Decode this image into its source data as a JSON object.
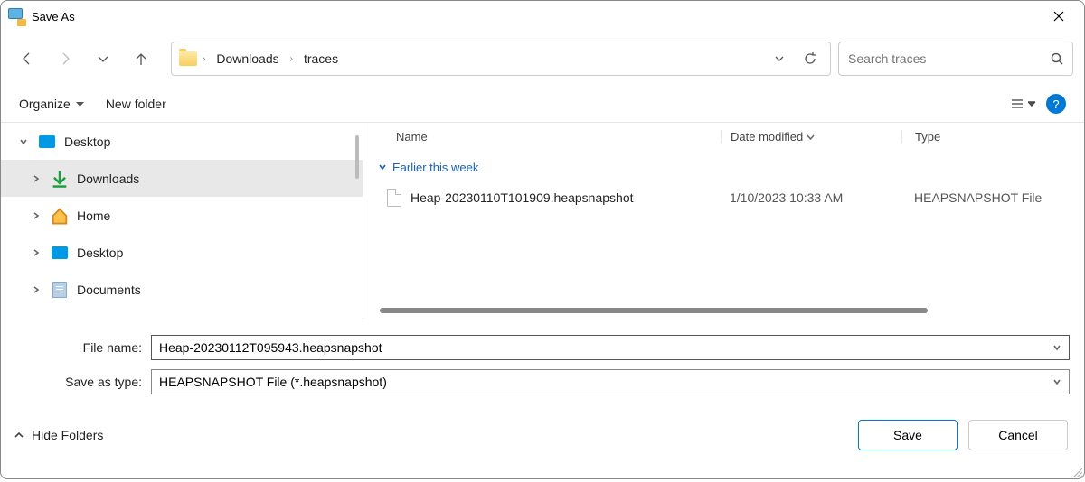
{
  "window": {
    "title": "Save As"
  },
  "breadcrumb": {
    "segments": [
      "Downloads",
      "traces"
    ]
  },
  "search": {
    "placeholder": "Search traces"
  },
  "toolbar": {
    "organize": "Organize",
    "newfolder": "New folder"
  },
  "sidebar": {
    "items": [
      {
        "label": "Desktop"
      },
      {
        "label": "Downloads"
      },
      {
        "label": "Home"
      },
      {
        "label": "Desktop"
      },
      {
        "label": "Documents"
      }
    ]
  },
  "columns": {
    "name": "Name",
    "date": "Date modified",
    "type": "Type"
  },
  "group": {
    "label": "Earlier this week"
  },
  "files": [
    {
      "name": "Heap-20230110T101909.heapsnapshot",
      "date": "1/10/2023 10:33 AM",
      "type": "HEAPSNAPSHOT File"
    }
  ],
  "form": {
    "filename_label": "File name:",
    "filename_value": "Heap-20230112T095943.heapsnapshot",
    "savetype_label": "Save as type:",
    "savetype_value": "HEAPSNAPSHOT File (*.heapsnapshot)"
  },
  "footer": {
    "hide_folders": "Hide Folders",
    "save": "Save",
    "cancel": "Cancel"
  }
}
